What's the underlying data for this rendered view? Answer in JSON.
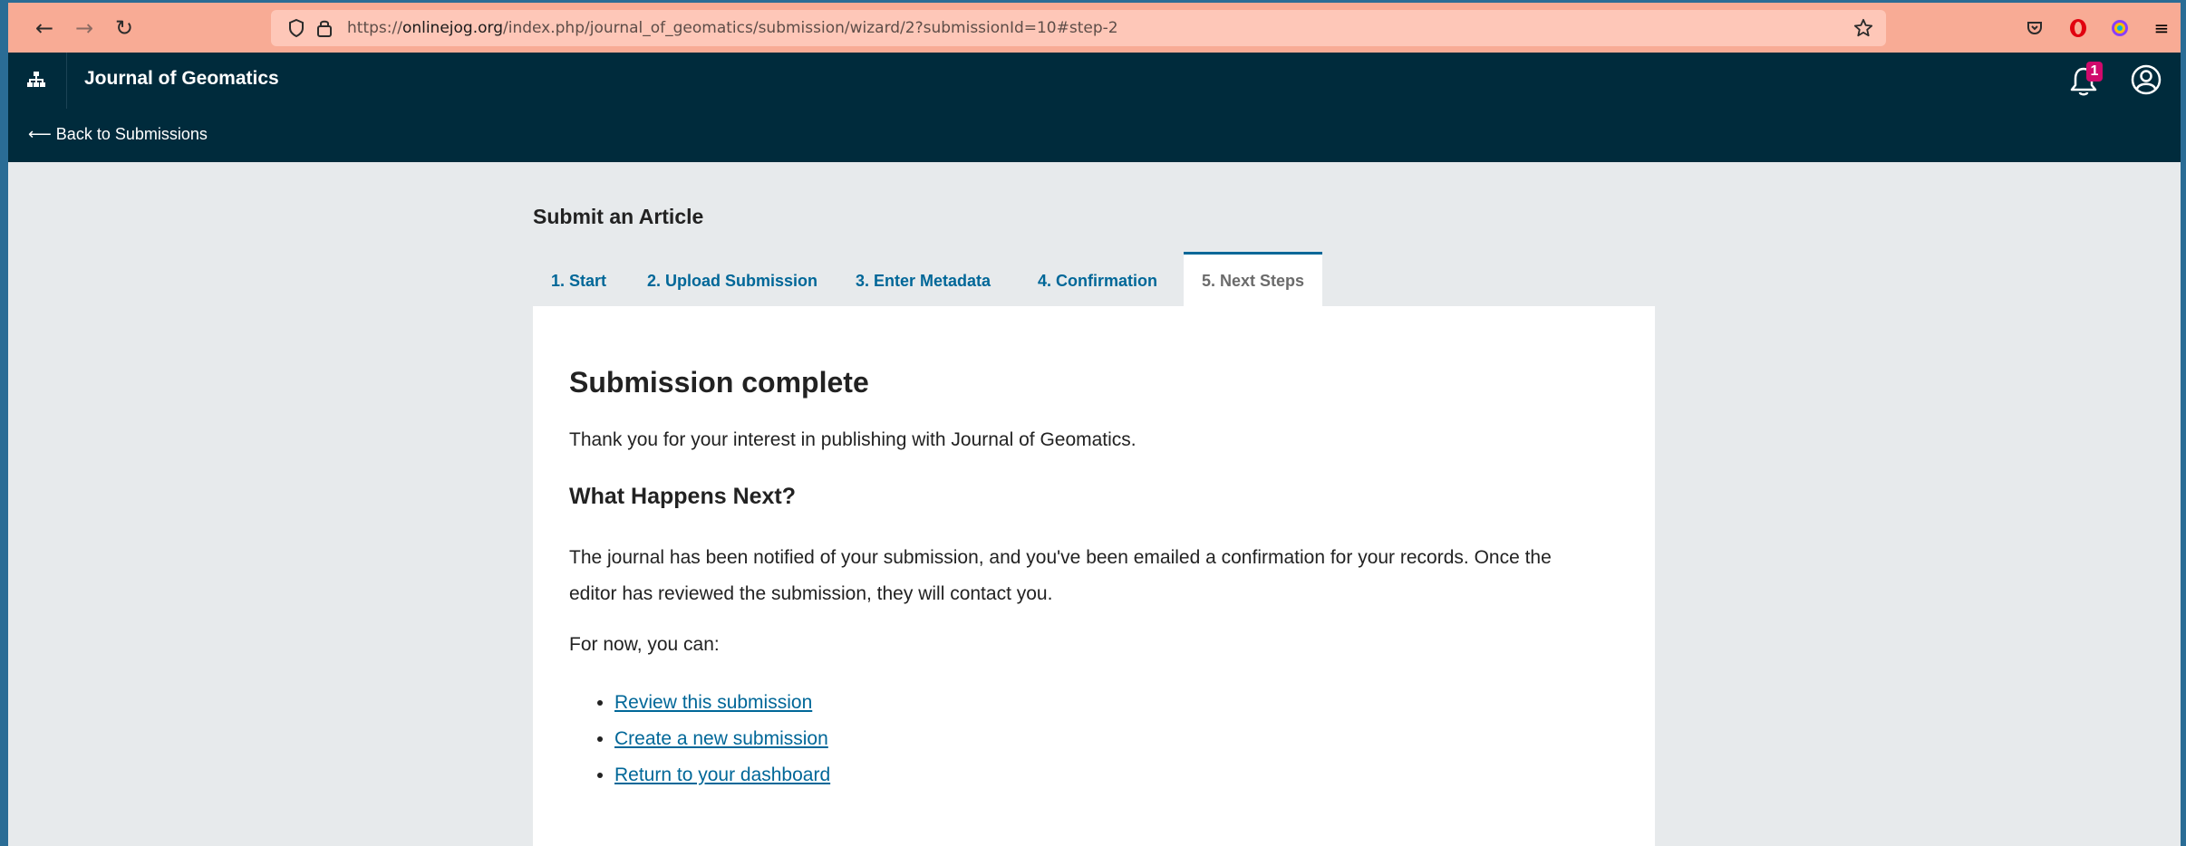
{
  "browser": {
    "url_prefix": "https://",
    "url_domain": "onlinejog.org",
    "url_path": "/index.php/journal_of_geomatics/submission/wizard/2?submissionId=10#step-2",
    "icons": [
      "back-arrow-icon",
      "forward-arrow-icon",
      "reload-icon",
      "shield-icon",
      "lock-icon",
      "star-icon",
      "pocket-icon",
      "opera-icon",
      "color-icon",
      "menu-icon"
    ]
  },
  "header": {
    "journal_title": "Journal of Geomatics",
    "back_link": "⟵ Back to Submissions",
    "notification_count": "1"
  },
  "page": {
    "title": "Submit an Article",
    "tabs": [
      {
        "label": "1. Start"
      },
      {
        "label": "2. Upload Submission"
      },
      {
        "label": "3. Enter Metadata"
      },
      {
        "label": "4. Confirmation"
      },
      {
        "label": "5. Next Steps",
        "active": true
      }
    ]
  },
  "content": {
    "heading": "Submission complete",
    "thanks": "Thank you for your interest in publishing with Journal of Geomatics.",
    "subheading": "What Happens Next?",
    "notified_line1": "The journal has been notified of your submission, and you've been emailed a confirmation for your records. Once the",
    "notified_line2": "editor has reviewed the submission, they will contact you.",
    "for_now": "For now, you can:",
    "links": [
      {
        "label": "Review this submission"
      },
      {
        "label": "Create a new submission"
      },
      {
        "label": "Return to your dashboard"
      }
    ]
  },
  "colors": {
    "browser_bar": "#f8ab95",
    "url_bar": "#fec7b8",
    "header_bg": "#002b3c",
    "link": "#006798",
    "page_bg": "#e7eaec",
    "badge": "#d00a6c"
  }
}
